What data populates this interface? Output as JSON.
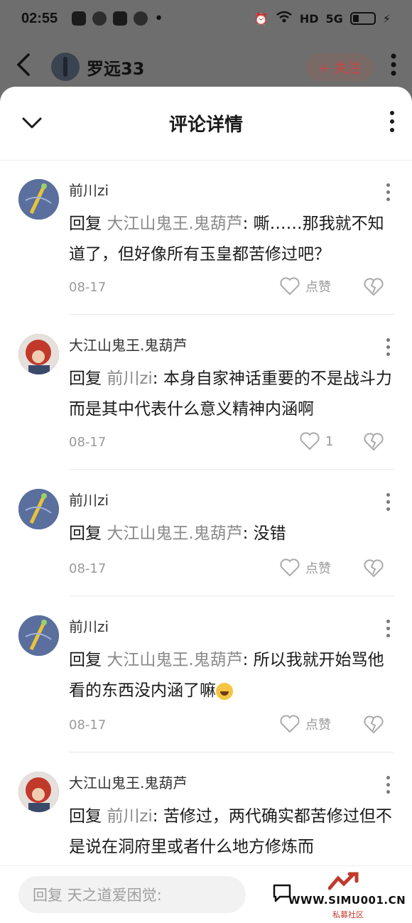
{
  "status_bar": {
    "time": "02:55",
    "signal_label": "5G",
    "hd_label": "HD"
  },
  "header": {
    "back_icon": "chevron-left-icon",
    "user_name": "罗远33",
    "follow_label": "+ 关注"
  },
  "sheet": {
    "title": "评论详情"
  },
  "comments": [
    {
      "author": "前川zi",
      "reply_prefix": "回复 ",
      "reply_target": "大江山鬼王.鬼葫芦",
      "text": ": 嘶……那我就不知道了，但好像所有玉皇都苦修过吧？",
      "date": "08-17",
      "like_label": "点赞"
    },
    {
      "author": "大江山鬼王.鬼葫芦",
      "reply_prefix": "回复 ",
      "reply_target": "前川zi",
      "text": ": 本身自家神话重要的不是战斗力而是其中代表什么意义精神内涵啊",
      "date": "08-17",
      "like_label": "1"
    },
    {
      "author": "前川zi",
      "reply_prefix": "回复 ",
      "reply_target": "大江山鬼王.鬼葫芦",
      "text": ": 没错",
      "date": "08-17",
      "like_label": "点赞"
    },
    {
      "author": "前川zi",
      "reply_prefix": "回复 ",
      "reply_target": "大江山鬼王.鬼葫芦",
      "text": ": 所以我就开始骂他看的东西没内涵了嘛",
      "date": "08-17",
      "like_label": "点赞"
    },
    {
      "author": "大江山鬼王.鬼葫芦",
      "reply_prefix": "回复 ",
      "reply_target": "前川zi",
      "text": ": 苦修过，两代确实都苦修过但不是说在洞府里或者什么地方修炼而",
      "date": "",
      "like_label": ""
    }
  ],
  "input": {
    "placeholder": "回复 天之道爱困觉:"
  },
  "watermark": {
    "url": "WWW.SIMU001.CN",
    "sub": "私募社区"
  },
  "colors": {
    "overlay": "#6e6e6e",
    "reply_target": "#8a8a8a",
    "follow": "#cc4444"
  }
}
